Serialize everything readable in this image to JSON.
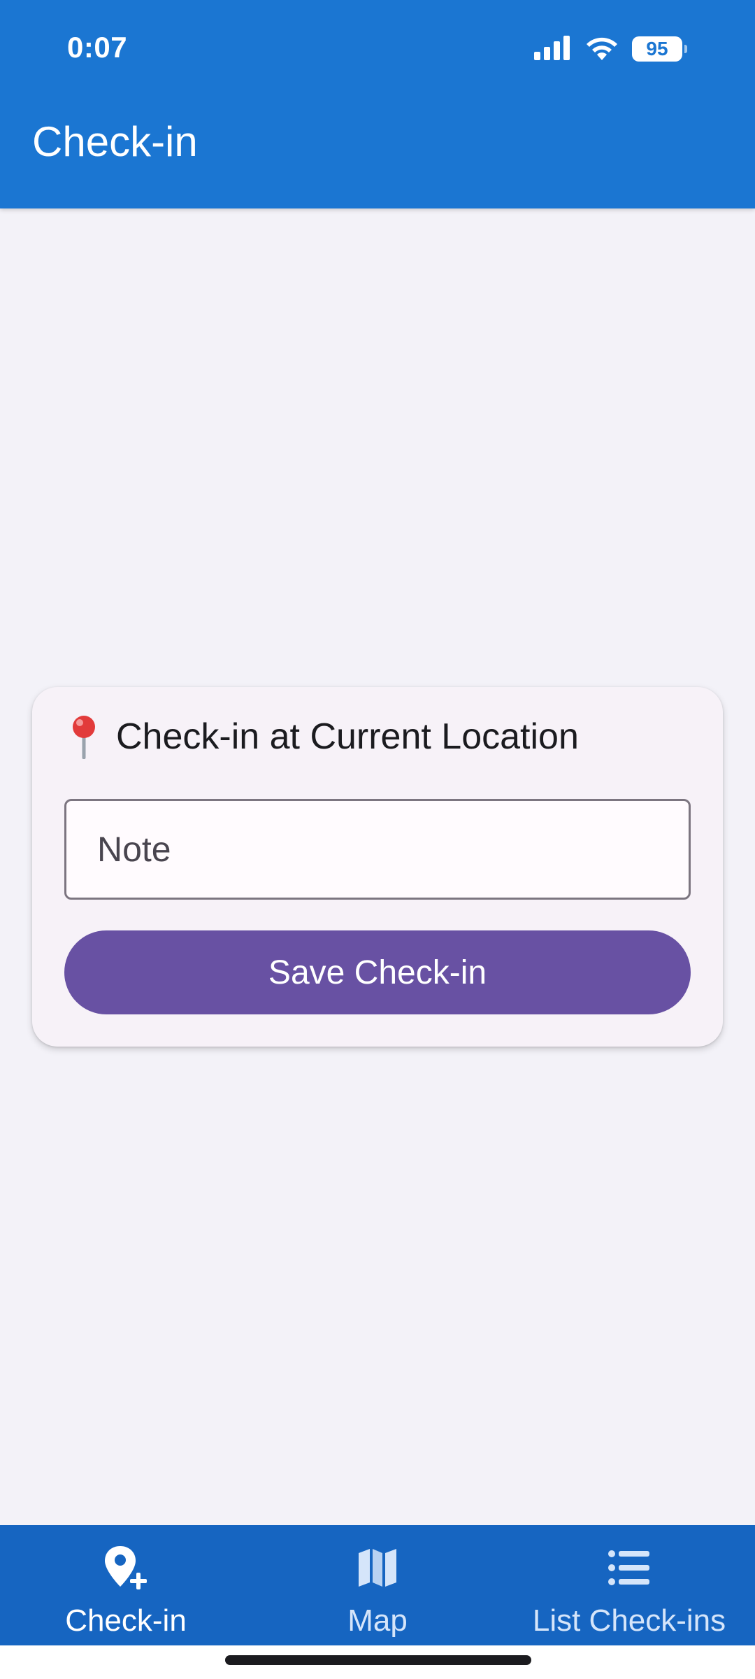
{
  "status_bar": {
    "time": "0:07",
    "battery": "95",
    "icons": [
      "cellular-signal-icon",
      "wifi-icon",
      "battery-icon"
    ]
  },
  "app_bar": {
    "title": "Check-in"
  },
  "card": {
    "icon": "pin-icon",
    "title": "Check-in at Current Location",
    "note_placeholder": "Note",
    "note_value": "",
    "save_label": "Save Check-in"
  },
  "bottom_nav": {
    "items": [
      {
        "label": "Check-in",
        "icon": "add-location-icon",
        "active": true
      },
      {
        "label": "Map",
        "icon": "map-icon",
        "active": false
      },
      {
        "label": "List Check-ins",
        "icon": "list-icon",
        "active": false
      }
    ]
  },
  "colors": {
    "app_bar": "#1b76d2",
    "bottom_nav": "#1665c1",
    "primary_button": "#6851a3",
    "background": "#f3f2f8",
    "card": "#f7f2f8"
  }
}
